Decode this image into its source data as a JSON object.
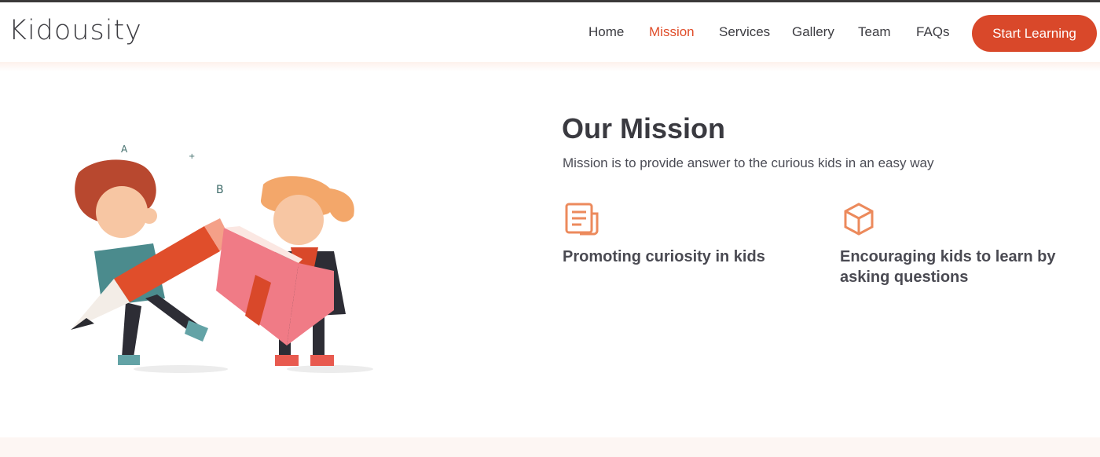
{
  "header": {
    "brand": "Kidousity",
    "nav": [
      "Home",
      "Mission",
      "Services",
      "Gallery",
      "Team",
      "FAQs"
    ],
    "active_nav": "Mission",
    "cta_label": "Start Learning"
  },
  "mission": {
    "title": "Our Mission",
    "subtitle": "Mission is to provide answer to the curious kids in an easy way",
    "features": [
      {
        "icon": "document-icon",
        "text": "Promoting curiosity in kids"
      },
      {
        "icon": "cube-icon",
        "text": "Encouraging kids to learn by asking questions"
      }
    ]
  },
  "colors": {
    "accent": "#d9482a",
    "active_nav": "#e04e2b",
    "text": "#3f4046",
    "icon": "#ec8a5c"
  }
}
